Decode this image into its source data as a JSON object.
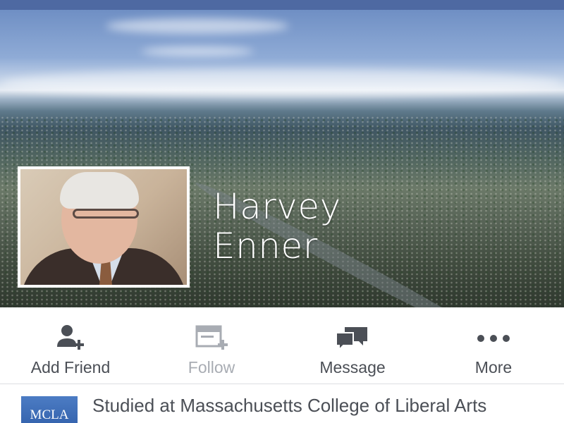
{
  "profile": {
    "name_line1": "Harvey",
    "name_line2": "Enner"
  },
  "actions": [
    {
      "label": "Add Friend",
      "icon": "add-friend-icon",
      "enabled": true
    },
    {
      "label": "Follow",
      "icon": "follow-icon",
      "enabled": false
    },
    {
      "label": "Message",
      "icon": "message-icon",
      "enabled": true
    },
    {
      "label": "More",
      "icon": "more-icon",
      "enabled": true
    }
  ],
  "about": {
    "education_text": "Studied at Massachusetts College of Liberal Arts",
    "school_logo_text": "MCLA"
  },
  "colors": {
    "topbar": "#4e69a2",
    "icon": "#4b4f56",
    "icon_disabled": "#a8acb3",
    "text": "#4b4f56"
  }
}
